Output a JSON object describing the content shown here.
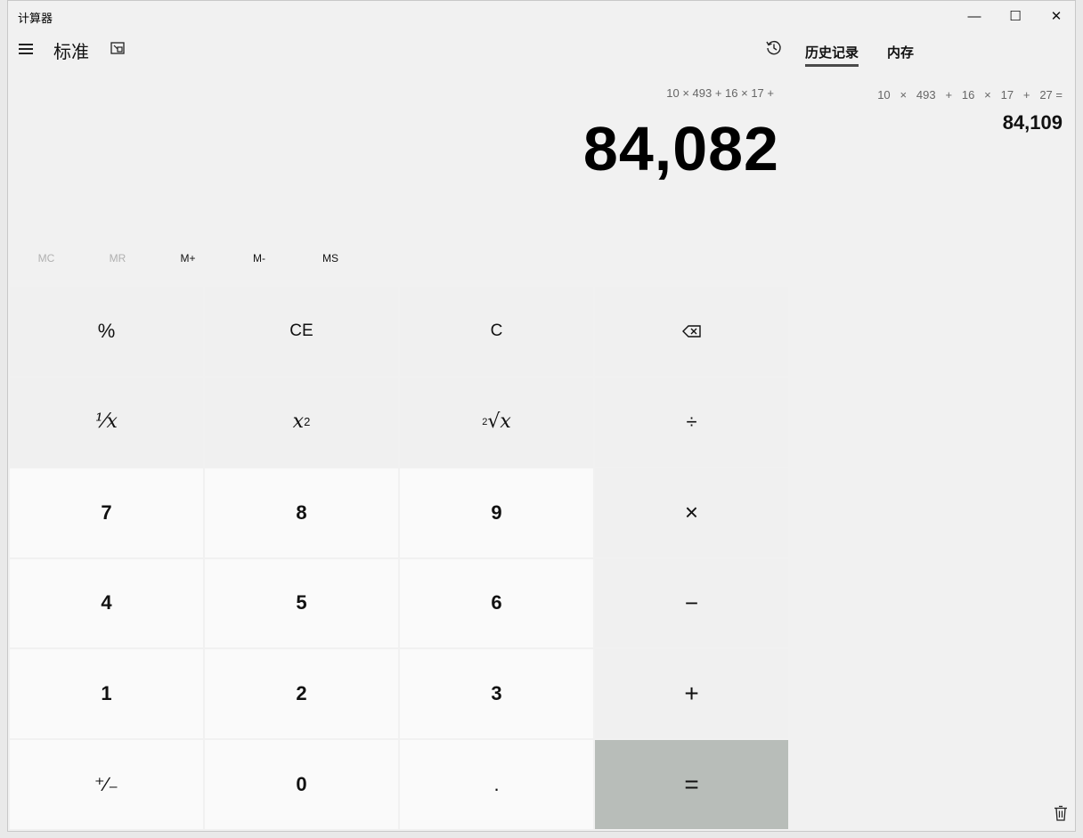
{
  "window": {
    "title": "计算器",
    "minimize_glyph": "—",
    "maximize_glyph": "☐",
    "close_glyph": "✕"
  },
  "header": {
    "mode": "标准",
    "tabs": [
      {
        "label": "历史记录",
        "active": true
      },
      {
        "label": "内存",
        "active": false
      }
    ]
  },
  "display": {
    "expression": "10 × 493 + 16 × 17 +",
    "value": "84,082"
  },
  "memory": {
    "buttons": [
      {
        "label": "MC",
        "enabled": false
      },
      {
        "label": "MR",
        "enabled": false
      },
      {
        "label": "M+",
        "enabled": true
      },
      {
        "label": "M-",
        "enabled": true
      },
      {
        "label": "MS",
        "enabled": true
      }
    ]
  },
  "keys": {
    "percent": "%",
    "ce": "CE",
    "c": "C",
    "backspace": "⌫",
    "reciprocal": "⅟x",
    "square_base": "x",
    "square_exp": "2",
    "sqrt_idx": "2",
    "sqrt_sym": "√x",
    "divide": "÷",
    "seven": "7",
    "eight": "8",
    "nine": "9",
    "multiply": "×",
    "four": "4",
    "five": "5",
    "six": "6",
    "minus": "−",
    "one": "1",
    "two": "2",
    "three": "3",
    "plus": "+",
    "negate": "⁺∕₋",
    "zero": "0",
    "decimal": ".",
    "equals": "="
  },
  "history": {
    "expression": "10   ×   493   +   16   ×   17   +   27 =",
    "result": "84,109"
  },
  "colors": {
    "equals_bg": "#b8bdb9",
    "tab_underline": "#4a4a4a"
  }
}
